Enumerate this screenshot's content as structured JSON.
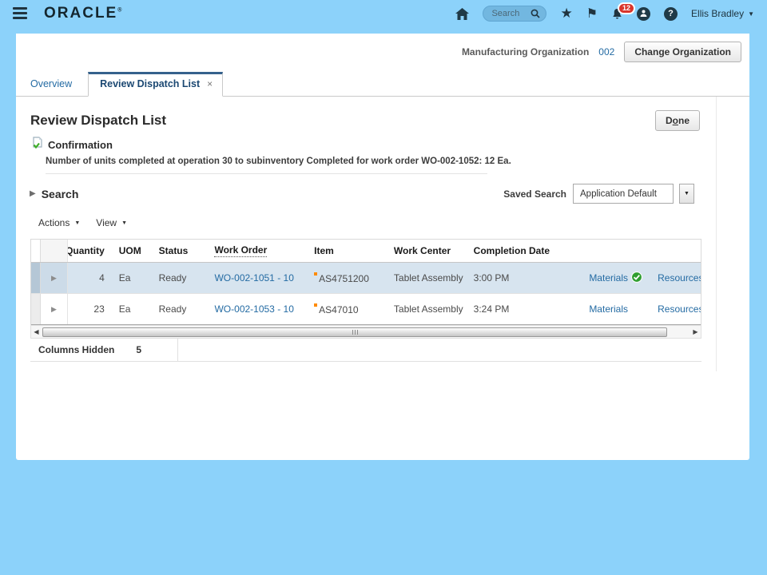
{
  "colors": {
    "header_bg": "#8cd2fa",
    "link_blue": "#246ba3",
    "selected_row": "#d7e4ef",
    "badge_red": "#d9352b",
    "success_green": "#2f9e2f",
    "item_marker_orange": "#ff8b00",
    "active_tab_accent": "#35618c"
  },
  "header": {
    "logo": "ORACLE",
    "logo_mark": "®",
    "search_placeholder": "Search",
    "notification_count": "12",
    "user_name": "Ellis Bradley"
  },
  "org_bar": {
    "label": "Manufacturing Organization",
    "code": "002",
    "change_button": "Change Organization"
  },
  "tabs": [
    {
      "label": "Overview"
    },
    {
      "label": "Review Dispatch List",
      "close": "×"
    }
  ],
  "page": {
    "title": "Review Dispatch List",
    "done_button": {
      "pre": "D",
      "accel": "o",
      "post": "ne"
    },
    "confirmation": {
      "title": "Confirmation",
      "message": "Number of units completed at operation 30 to subinventory Completed for work order WO-002-1052: 12 Ea."
    },
    "search_label": "Search",
    "saved_search_label": "Saved Search",
    "saved_search_value": "Application Default",
    "actions_label": "Actions",
    "view_label": "View"
  },
  "table": {
    "columns": [
      "Quantity",
      "UOM",
      "Status",
      "Work Order",
      "Item",
      "Work Center",
      "Completion Date"
    ],
    "rows": [
      {
        "quantity": "4",
        "uom": "Ea",
        "status": "Ready",
        "work_order": "WO-002-1051 - 10",
        "item": "AS4751200",
        "work_center": "Tablet Assembly",
        "completion_date": "3:00 PM",
        "materials": "Materials",
        "resources": "Resources"
      },
      {
        "quantity": "23",
        "uom": "Ea",
        "status": "Ready",
        "work_order": "WO-002-1053 - 10",
        "item": "AS47010",
        "work_center": "Tablet Assembly",
        "completion_date": "3:24 PM",
        "materials": "Materials",
        "resources": "Resources"
      }
    ],
    "footer": {
      "label": "Columns Hidden",
      "count": "5"
    }
  }
}
